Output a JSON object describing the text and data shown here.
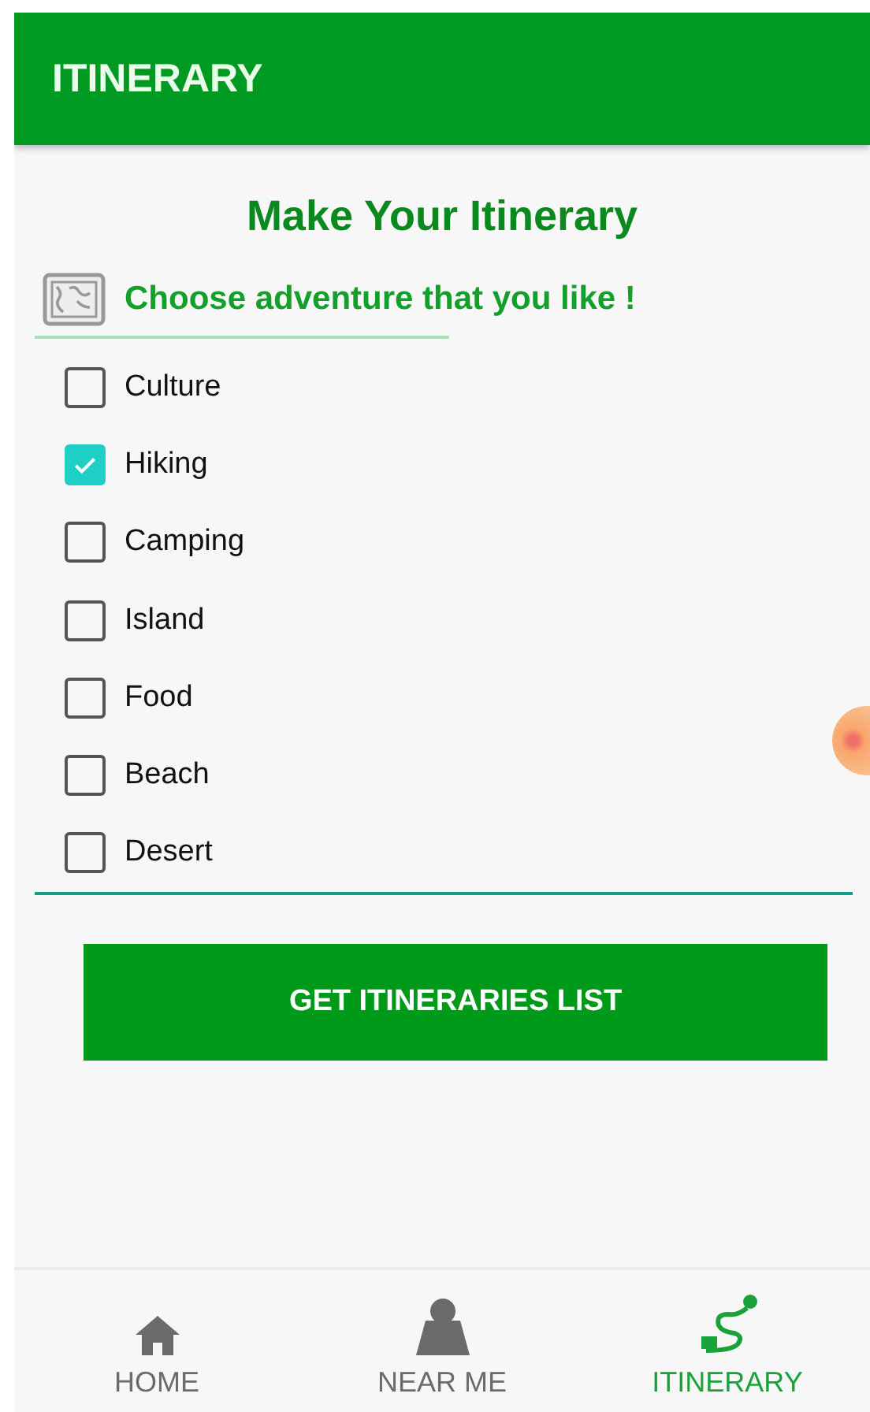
{
  "app_bar": {
    "title": "ITINERARY"
  },
  "heading": "Make Your Itinerary",
  "subheading": "Choose adventure that you like !",
  "options": [
    {
      "label": "Culture",
      "checked": false
    },
    {
      "label": "Hiking",
      "checked": true
    },
    {
      "label": "Camping",
      "checked": false
    },
    {
      "label": "Island",
      "checked": false
    },
    {
      "label": "Food",
      "checked": false
    },
    {
      "label": "Beach",
      "checked": false
    },
    {
      "label": "Desert",
      "checked": false
    }
  ],
  "button": "GET ITINERARIES LIST",
  "bottom_nav": [
    {
      "label": "HOME",
      "kind": "home",
      "selected": false
    },
    {
      "label": "NEAR ME",
      "kind": "person",
      "selected": false
    },
    {
      "label": "ITINERARY",
      "kind": "route",
      "selected": true
    }
  ]
}
